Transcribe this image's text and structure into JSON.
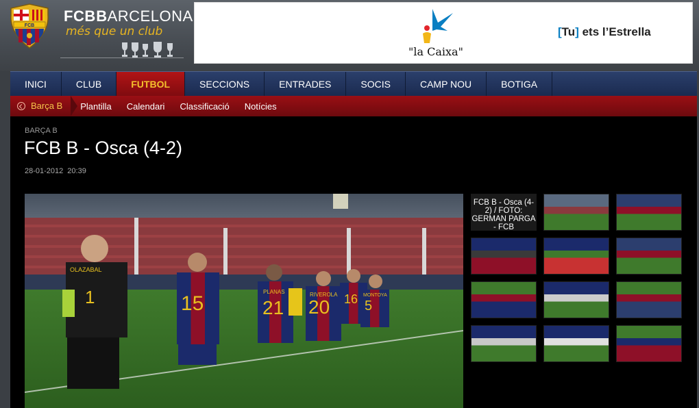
{
  "brand": {
    "name_bold": "FCB",
    "name_rest": "ARCELONA",
    "motto": "més que un club"
  },
  "ad": {
    "brand": "\"la Caixa\"",
    "slogan_open": "[",
    "slogan_tu": "Tu",
    "slogan_close": "]",
    "slogan_rest": " ets l’Estrella",
    "colors": {
      "star_blue": "#0a7fc2",
      "star_red": "#e3262c",
      "star_yellow": "#f2b618"
    }
  },
  "main_nav": [
    {
      "label": "INICI",
      "active": false
    },
    {
      "label": "CLUB",
      "active": false
    },
    {
      "label": "FUTBOL",
      "active": true
    },
    {
      "label": "SECCIONS",
      "active": false
    },
    {
      "label": "ENTRADES",
      "active": false
    },
    {
      "label": "SOCIS",
      "active": false
    },
    {
      "label": "CAMP NOU",
      "active": false
    },
    {
      "label": "BOTIGA",
      "active": false
    }
  ],
  "sub_nav": {
    "current": "Barça B",
    "items": [
      "Plantilla",
      "Calendari",
      "Classificació",
      "Notícies"
    ]
  },
  "article": {
    "section": "BARÇA B",
    "title": "FCB B - Osca (4-2)",
    "date": "28-01-2012",
    "time": "20:39"
  },
  "gallery": {
    "caption": "FCB B - Osca (4-2) / FOTO: GERMAN PARGA - FCB"
  },
  "main_photo": {
    "shirts": [
      "1",
      "15",
      "21",
      "20",
      "16",
      "5"
    ],
    "names": [
      "OLAZABAL",
      "PLANAS",
      "RIVEROLA",
      "MONTOYA"
    ]
  },
  "colors": {
    "nav_blue": "#1a2a4f",
    "nav_red": "#9a0f14",
    "active_text": "#f4c02c",
    "brand_gold": "#e8b520"
  }
}
